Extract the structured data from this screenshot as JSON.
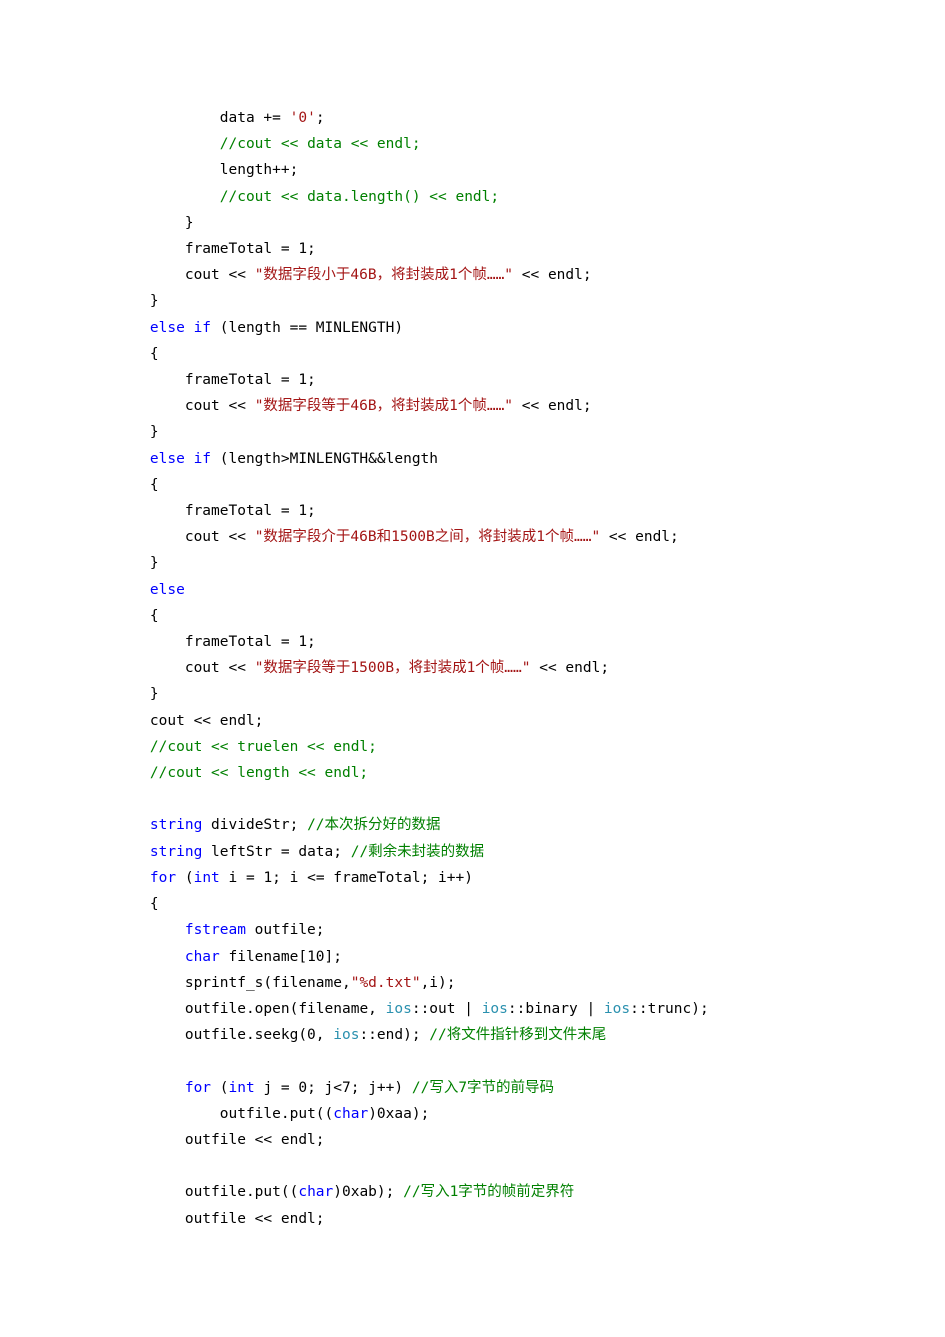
{
  "code": {
    "lines": [
      {
        "i": "            ",
        "t": [
          {
            "c": "op",
            "v": "data += "
          },
          {
            "c": "str",
            "v": "'0'"
          },
          {
            "c": "op",
            "v": ";"
          }
        ]
      },
      {
        "i": "            ",
        "t": [
          {
            "c": "cm",
            "v": "//cout << data << endl;"
          }
        ]
      },
      {
        "i": "            ",
        "t": [
          {
            "c": "op",
            "v": "length++;"
          }
        ]
      },
      {
        "i": "            ",
        "t": [
          {
            "c": "cm",
            "v": "//cout << data.length() << endl;"
          }
        ]
      },
      {
        "i": "        ",
        "t": [
          {
            "c": "op",
            "v": "}"
          }
        ]
      },
      {
        "i": "        ",
        "t": [
          {
            "c": "op",
            "v": "frameTotal = 1;"
          }
        ]
      },
      {
        "i": "        ",
        "t": [
          {
            "c": "op",
            "v": "cout << "
          },
          {
            "c": "str",
            "v": "\"数据字段小于46B，将封装成1个帧……\""
          },
          {
            "c": "op",
            "v": " << endl;"
          }
        ]
      },
      {
        "i": "    ",
        "t": [
          {
            "c": "op",
            "v": "}"
          }
        ]
      },
      {
        "i": "    ",
        "t": [
          {
            "c": "kw",
            "v": "else if"
          },
          {
            "c": "op",
            "v": " (length == MINLENGTH)"
          }
        ]
      },
      {
        "i": "    ",
        "t": [
          {
            "c": "op",
            "v": "{"
          }
        ]
      },
      {
        "i": "        ",
        "t": [
          {
            "c": "op",
            "v": "frameTotal = 1;"
          }
        ]
      },
      {
        "i": "        ",
        "t": [
          {
            "c": "op",
            "v": "cout << "
          },
          {
            "c": "str",
            "v": "\"数据字段等于46B，将封装成1个帧……\""
          },
          {
            "c": "op",
            "v": " << endl;"
          }
        ]
      },
      {
        "i": "    ",
        "t": [
          {
            "c": "op",
            "v": "}"
          }
        ]
      },
      {
        "i": "    ",
        "t": [
          {
            "c": "kw",
            "v": "else if"
          },
          {
            "c": "op",
            "v": " (length>MINLENGTH&&length"
          }
        ]
      },
      {
        "i": "    ",
        "t": [
          {
            "c": "op",
            "v": "{"
          }
        ]
      },
      {
        "i": "        ",
        "t": [
          {
            "c": "op",
            "v": "frameTotal = 1;"
          }
        ]
      },
      {
        "i": "        ",
        "t": [
          {
            "c": "op",
            "v": "cout << "
          },
          {
            "c": "str",
            "v": "\"数据字段介于46B和1500B之间，将封装成1个帧……\""
          },
          {
            "c": "op",
            "v": " << endl;"
          }
        ]
      },
      {
        "i": "    ",
        "t": [
          {
            "c": "op",
            "v": "}"
          }
        ]
      },
      {
        "i": "    ",
        "t": [
          {
            "c": "kw",
            "v": "else"
          }
        ]
      },
      {
        "i": "    ",
        "t": [
          {
            "c": "op",
            "v": "{"
          }
        ]
      },
      {
        "i": "        ",
        "t": [
          {
            "c": "op",
            "v": "frameTotal = 1;"
          }
        ]
      },
      {
        "i": "        ",
        "t": [
          {
            "c": "op",
            "v": "cout << "
          },
          {
            "c": "str",
            "v": "\"数据字段等于1500B，将封装成1个帧……\""
          },
          {
            "c": "op",
            "v": " << endl;"
          }
        ]
      },
      {
        "i": "    ",
        "t": [
          {
            "c": "op",
            "v": "}"
          }
        ]
      },
      {
        "i": "    ",
        "t": [
          {
            "c": "op",
            "v": "cout << endl;"
          }
        ]
      },
      {
        "i": "    ",
        "t": [
          {
            "c": "cm",
            "v": "//cout << truelen << endl;"
          }
        ]
      },
      {
        "i": "    ",
        "t": [
          {
            "c": "cm",
            "v": "//cout << length << endl;"
          }
        ]
      },
      {
        "i": "",
        "t": []
      },
      {
        "i": "    ",
        "t": [
          {
            "c": "kw",
            "v": "string"
          },
          {
            "c": "op",
            "v": " divideStr; "
          },
          {
            "c": "cm",
            "v": "//本次拆分好的数据"
          }
        ]
      },
      {
        "i": "    ",
        "t": [
          {
            "c": "kw",
            "v": "string"
          },
          {
            "c": "op",
            "v": " leftStr = data; "
          },
          {
            "c": "cm",
            "v": "//剩余未封装的数据"
          }
        ]
      },
      {
        "i": "    ",
        "t": [
          {
            "c": "kw",
            "v": "for"
          },
          {
            "c": "op",
            "v": " ("
          },
          {
            "c": "kw",
            "v": "int"
          },
          {
            "c": "op",
            "v": " i = 1; i <= frameTotal; i++)"
          }
        ]
      },
      {
        "i": "    ",
        "t": [
          {
            "c": "op",
            "v": "{"
          }
        ]
      },
      {
        "i": "        ",
        "t": [
          {
            "c": "kw",
            "v": "fstream"
          },
          {
            "c": "op",
            "v": " outfile;"
          }
        ]
      },
      {
        "i": "        ",
        "t": [
          {
            "c": "kw",
            "v": "char"
          },
          {
            "c": "op",
            "v": " filename[10];"
          }
        ]
      },
      {
        "i": "        ",
        "t": [
          {
            "c": "op",
            "v": "sprintf_s(filename,"
          },
          {
            "c": "str",
            "v": "\"%d.txt\""
          },
          {
            "c": "op",
            "v": ",i);"
          }
        ]
      },
      {
        "i": "        ",
        "t": [
          {
            "c": "op",
            "v": "outfile.open(filename, "
          },
          {
            "c": "ns",
            "v": "ios"
          },
          {
            "c": "op",
            "v": "::out | "
          },
          {
            "c": "ns",
            "v": "ios"
          },
          {
            "c": "op",
            "v": "::binary | "
          },
          {
            "c": "ns",
            "v": "ios"
          },
          {
            "c": "op",
            "v": "::trunc);"
          }
        ]
      },
      {
        "i": "        ",
        "t": [
          {
            "c": "op",
            "v": "outfile.seekg(0, "
          },
          {
            "c": "ns",
            "v": "ios"
          },
          {
            "c": "op",
            "v": "::end); "
          },
          {
            "c": "cm",
            "v": "//将文件指针移到文件末尾"
          }
        ]
      },
      {
        "i": "",
        "t": []
      },
      {
        "i": "        ",
        "t": [
          {
            "c": "kw",
            "v": "for"
          },
          {
            "c": "op",
            "v": " ("
          },
          {
            "c": "kw",
            "v": "int"
          },
          {
            "c": "op",
            "v": " j = 0; j<7; j++) "
          },
          {
            "c": "cm",
            "v": "//写入7字节的前导码"
          }
        ]
      },
      {
        "i": "            ",
        "t": [
          {
            "c": "op",
            "v": "outfile.put(("
          },
          {
            "c": "kw",
            "v": "char"
          },
          {
            "c": "op",
            "v": ")0xaa);"
          }
        ]
      },
      {
        "i": "        ",
        "t": [
          {
            "c": "op",
            "v": "outfile << endl;"
          }
        ]
      },
      {
        "i": "",
        "t": []
      },
      {
        "i": "        ",
        "t": [
          {
            "c": "op",
            "v": "outfile.put(("
          },
          {
            "c": "kw",
            "v": "char"
          },
          {
            "c": "op",
            "v": ")0xab); "
          },
          {
            "c": "cm",
            "v": "//写入1字节的帧前定界符"
          }
        ]
      },
      {
        "i": "        ",
        "t": [
          {
            "c": "op",
            "v": "outfile << endl;"
          }
        ]
      }
    ]
  }
}
